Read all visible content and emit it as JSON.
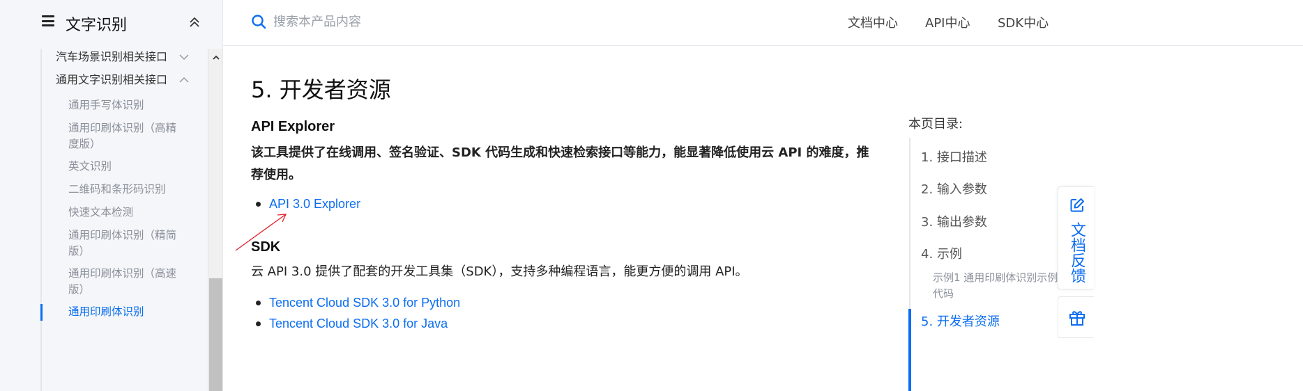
{
  "sidebar": {
    "title": "文字识别",
    "items": [
      {
        "label": "汽车场景识别相关接口"
      },
      {
        "label": "通用文字识别相关接口"
      },
      {
        "label": "通用手写体识别"
      },
      {
        "label": "通用印刷体识别（高精度版）"
      },
      {
        "label": "英文识别"
      },
      {
        "label": "二维码和条形码识别"
      },
      {
        "label": "快速文本检测"
      },
      {
        "label": "通用印刷体识别（精简版）"
      },
      {
        "label": "通用印刷体识别（高速版）"
      },
      {
        "label": "通用印刷体识别"
      }
    ]
  },
  "header": {
    "search_placeholder": "搜索本产品内容",
    "nav": [
      {
        "label": "文档中心"
      },
      {
        "label": "API中心"
      },
      {
        "label": "SDK中心"
      }
    ]
  },
  "main": {
    "section_title": "5. 开发者资源",
    "api_explorer": {
      "heading": "API Explorer",
      "description": "该工具提供了在线调用、签名验证、SDK 代码生成和快速检索接口等能力，能显著降低使用云 API 的难度，推荐使用。",
      "links": [
        {
          "label": "API 3.0 Explorer"
        }
      ]
    },
    "sdk": {
      "heading": "SDK",
      "description": "云 API 3.0 提供了配套的开发工具集（SDK），支持多种编程语言，能更方便的调用 API。",
      "links": [
        {
          "label": "Tencent Cloud SDK 3.0 for Python"
        },
        {
          "label": "Tencent Cloud SDK 3.0 for Java"
        }
      ]
    }
  },
  "toc": {
    "title": "本页目录:",
    "items": [
      {
        "label": "1. 接口描述"
      },
      {
        "label": "2. 输入参数"
      },
      {
        "label": "3. 输出参数"
      },
      {
        "label": "4. 示例"
      },
      {
        "label": "示例1 通用印刷体识别示例代码"
      },
      {
        "label": "5. 开发者资源"
      }
    ]
  },
  "feedback": {
    "label": "文档反馈"
  },
  "colors": {
    "accent": "#0b6df0",
    "annotation_arrow": "#e0202a"
  }
}
